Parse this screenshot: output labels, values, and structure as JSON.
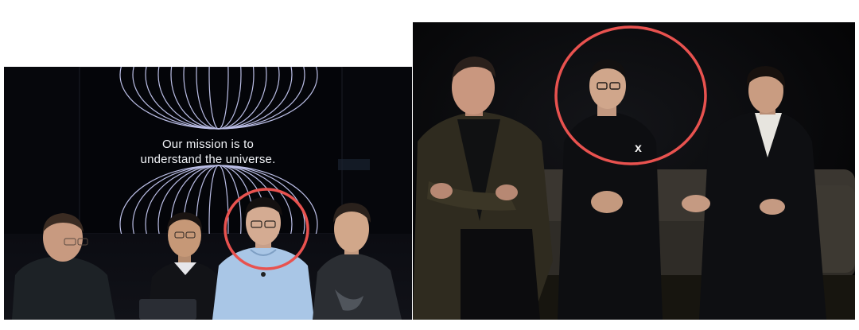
{
  "left_photo": {
    "slide_text_line1": "Our mission is to",
    "slide_text_line2": "understand the universe."
  },
  "right_photo": {
    "shirt_logo": "x"
  },
  "colors": {
    "highlight_circle": "#e8524f",
    "stage_background": "#05060a",
    "slide_lines": "#cfd3ff",
    "light_blue_shirt": "#a9c6e6"
  }
}
